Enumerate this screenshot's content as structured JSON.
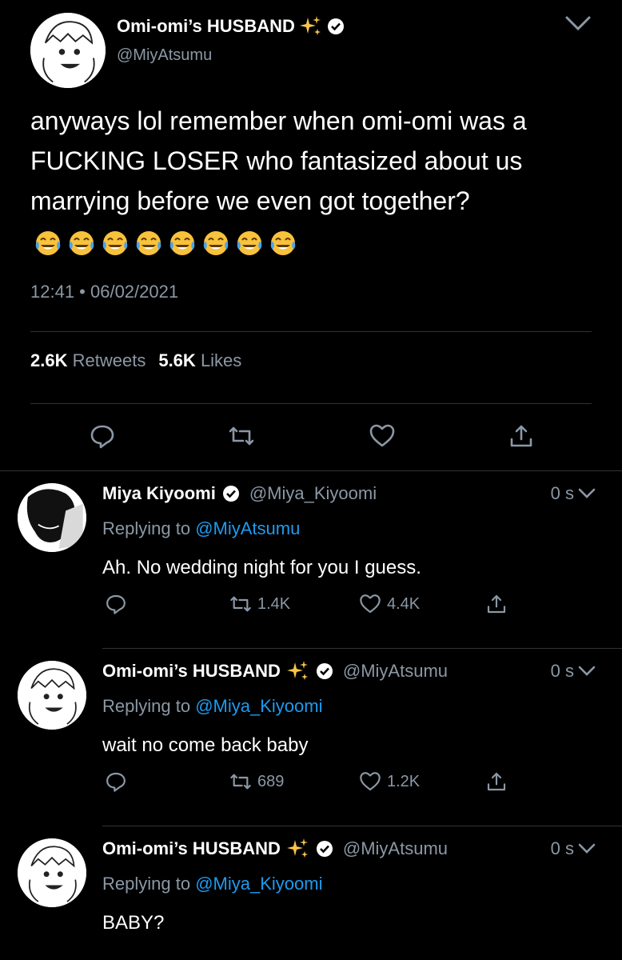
{
  "main_tweet": {
    "display_name": "Omi-omi’s HUSBAND",
    "handle": "@MiyAtsumu",
    "text": "anyways lol remember when omi-omi was a FUCKING LOSER who fantasized about us marrying before we even got together?",
    "emoji_count": 8,
    "emoji": "laughing-tears",
    "timestamp": "12:41 • 06/02/2021",
    "retweets_count": "2.6K",
    "retweets_label": "Retweets",
    "likes_count": "5.6K",
    "likes_label": "Likes"
  },
  "replies": [
    {
      "display_name": "Miya Kiyoomi",
      "handle": "@Miya_Kiyoomi",
      "time": "0 s",
      "replying_prefix": "Replying to",
      "replying_to": "@MiyAtsumu",
      "text": "Ah. No wedding night for you I guess.",
      "retweets": "1.4K",
      "likes": "4.4K",
      "has_sparkle": false
    },
    {
      "display_name": "Omi-omi’s HUSBAND",
      "handle": "@MiyAtsumu",
      "time": "0 s",
      "replying_prefix": "Replying to",
      "replying_to": "@Miya_Kiyoomi",
      "text": "wait no come back baby",
      "retweets": "689",
      "likes": "1.2K",
      "has_sparkle": true
    },
    {
      "display_name": "Omi-omi’s HUSBAND",
      "handle": "@MiyAtsumu",
      "time": "0 s",
      "replying_prefix": "Replying to",
      "replying_to": "@Miya_Kiyoomi",
      "text": "BABY?",
      "retweets": "",
      "likes": "",
      "has_sparkle": true
    }
  ],
  "colors": {
    "background": "#000000",
    "text": "#ffffff",
    "secondary": "#8b98a5",
    "link": "#1d9bf0",
    "divider": "#2f3336"
  }
}
